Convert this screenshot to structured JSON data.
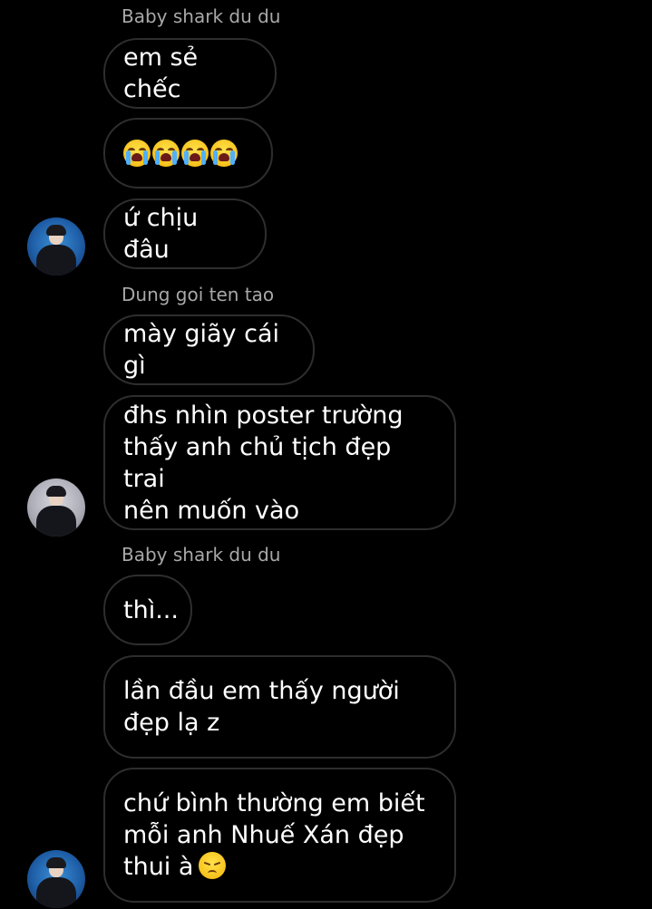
{
  "messages": [
    {
      "sender": "Baby shark du du"
    },
    {
      "text": "em sẻ chếc"
    },
    {
      "emoji": [
        "loudly-crying-face",
        "loudly-crying-face",
        "loudly-crying-face",
        "loudly-crying-face"
      ]
    },
    {
      "text": "ứ chịu đâu"
    },
    {
      "sender": "Dung goi ten tao"
    },
    {
      "text": "mày giãy cái gì"
    },
    {
      "text": "đhs nhìn poster trường\nthấy anh chủ tịch đẹp trai\nnên muốn vào"
    },
    {
      "sender": "Baby shark du du"
    },
    {
      "text": "thì..."
    },
    {
      "text": "lần đầu em thấy người\nđẹp lạ z"
    },
    {
      "text": "chứ bình thường em biết\nmỗi anh Nhuế Xán đẹp\nthui à",
      "trailing_emoji": "disappointed-face"
    }
  ],
  "avatars": [
    {
      "style": "blue-stage-photo"
    },
    {
      "style": "grey-studio-photo"
    },
    {
      "style": "blue-stage-photo"
    }
  ],
  "colors": {
    "background": "#000000",
    "bubble_border": "#2e2e2e",
    "message_text": "#ffffff",
    "sender_text": "#a8a8a8"
  }
}
